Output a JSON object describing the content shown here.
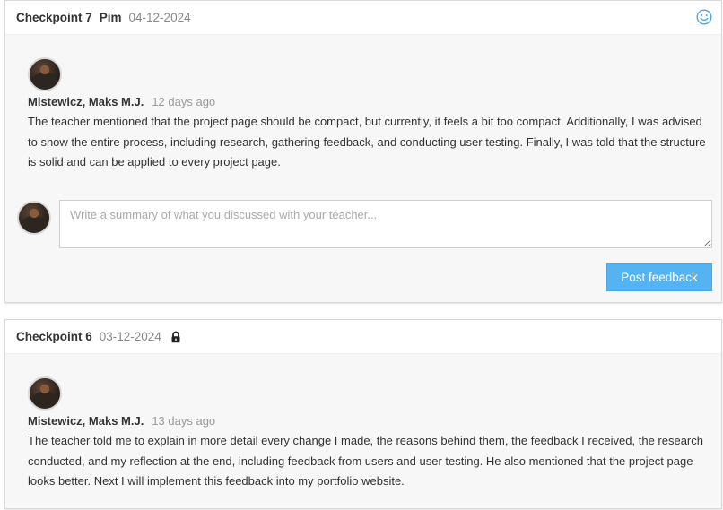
{
  "checkpoints": [
    {
      "title": "Checkpoint 7",
      "teacher": "Pim",
      "date": "04-12-2024",
      "status_icon": "smiley-icon",
      "comment": {
        "author": "Mistewicz, Maks M.J.",
        "time_ago": "12 days ago",
        "text": "The teacher mentioned that the project page should be compact, but currently, it feels a bit too compact. Additionally, I was advised to show the entire process, including research, gathering feedback, and conducting user testing. Finally, I was told that the structure is solid and can be applied to every project page."
      },
      "input_placeholder": "Write a summary of what you discussed with your teacher...",
      "input_value": "",
      "post_button_label": "Post feedback"
    },
    {
      "title": "Checkpoint 6",
      "date": "03-12-2024",
      "status_icon": "lock-icon",
      "comment": {
        "author": "Mistewicz, Maks M.J.",
        "time_ago": "13 days ago",
        "text": "The teacher told me to explain in more detail every change I made, the reasons behind them, the feedback I received, the research conducted, and my reflection at the end, including feedback from users and user testing. He also mentioned that the project page looks better. Next I will implement this feedback into my portfolio website."
      }
    }
  ],
  "colors": {
    "accent_button": "#55b3f2",
    "smiley_icon": "#4da6e8",
    "card_background": "#f7f7f7"
  }
}
